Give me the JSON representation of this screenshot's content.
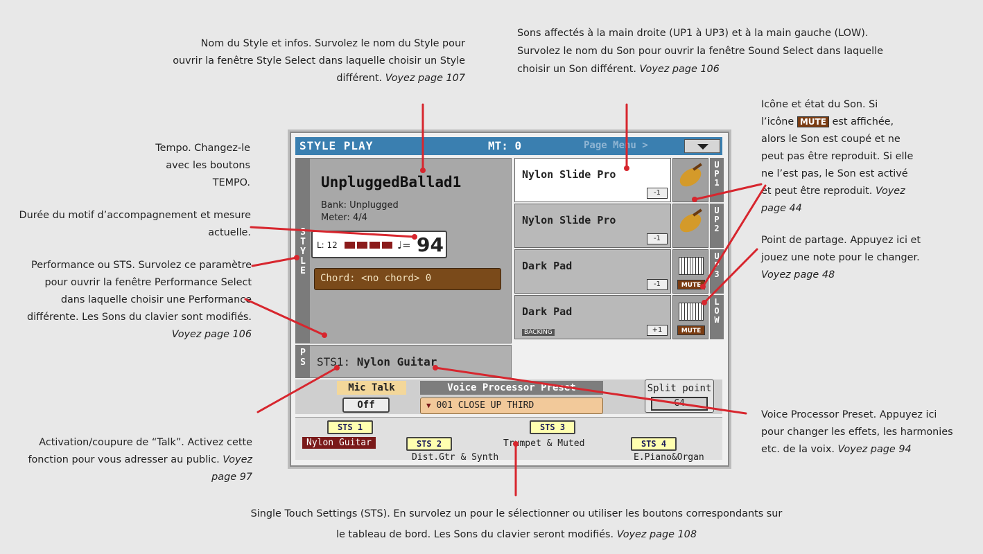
{
  "annotations": {
    "style_name": {
      "text": "Nom du Style et infos. Survolez le nom du Style pour ouvrir la fenêtre Style Select dans laquelle choisir un Style différent.",
      "ref": "Voyez page 107"
    },
    "sounds": {
      "text": "Sons affectés à la main droite (UP1 à UP3) et à la main gauche (LOW). Survolez le nom du Son pour ouvrir la fenêtre Sound Select dans laquelle choisir un Son différent.",
      "ref": "Voyez  page 106"
    },
    "icon_state": {
      "text_before": "Icône et état du Son. Si l’icône",
      "mute_label": "MUTE",
      "text_after": "est affichée, alors le Son est coupé et ne peut pas être reproduit. Si elle ne l’est pas, le Son est activé et peut être reproduit.",
      "ref": "Voyez page 44"
    },
    "tempo": {
      "text": "Tempo. Changez-le avec les boutons TEMPO."
    },
    "duration": {
      "text": "Durée du motif d’accompagnement et mesure actuelle."
    },
    "performance": {
      "text": "Performance ou STS. Survolez ce paramètre pour ouvrir la fenêtre Performance Select dans laquelle choisir une Performance différente. Les Sons du clavier sont modifiés.",
      "ref": "Voyez page 106"
    },
    "talk": {
      "text": "Activation/coupure de “Talk”. Activez cette fonction pour vous adresser au public.",
      "ref": "Voyez page 97"
    },
    "split": {
      "text": "Point de partage. Appuyez ici et jouez une note pour le changer.",
      "ref": "Voyez page 48"
    },
    "voice": {
      "text": "Voice Processor Preset. Appuyez ici pour changer les effets, les harmonies etc. de la voix.",
      "ref": "Voyez page 94"
    },
    "sts": {
      "text": "Single Touch Settings (STS). En survolez un pour le sélectionner ou utiliser les boutons correspondants sur le tableau de bord. Les Sons du clavier seront modifiés.",
      "ref": "Voyez  page 108"
    }
  },
  "screen": {
    "title": "STYLE PLAY",
    "mt": "MT: 0",
    "page_menu": "Page Menu >",
    "style_label": "STYLE",
    "style_name": "UnpluggedBallad1",
    "bank": "Bank:  Unplugged",
    "meter": "Meter:  4/4",
    "length": "L: 12",
    "tempo_symbol": "♩=",
    "tempo": "94",
    "chord": "Chord: <no chord> 0",
    "ps_label": "PS",
    "ps_prefix": "STS1: ",
    "ps_name": "Nylon Guitar",
    "tracks": [
      {
        "name": "Nylon Slide Pro",
        "octave": "-1",
        "label": "UP1",
        "icon": "guitar-icon",
        "muted": false,
        "selected": true
      },
      {
        "name": "Nylon Slide Pro",
        "octave": "-1",
        "label": "UP2",
        "icon": "guitar-icon",
        "muted": false,
        "selected": false
      },
      {
        "name": "Dark Pad",
        "octave": "-1",
        "label": "UP3",
        "icon": "pad-icon",
        "muted": true,
        "selected": false
      },
      {
        "name": "Dark Pad",
        "octave": "+1",
        "label": "LOW",
        "icon": "pad-icon",
        "muted": true,
        "selected": false,
        "badge": "BACKING"
      }
    ],
    "mute_label": "MUTE",
    "mic_talk_label": "Mic Talk",
    "mic_talk_value": "Off",
    "voice_label": "Voice Processor Preset",
    "voice_value": "001 CLOSE UP THIRD",
    "split_label": "Split point",
    "split_value": "C4",
    "sts": [
      {
        "button": "STS 1",
        "name": "Nylon Guitar"
      },
      {
        "button": "STS 2",
        "name": "Dist.Gtr & Synth"
      },
      {
        "button": "STS 3",
        "name": "Trumpet & Muted"
      },
      {
        "button": "STS 4",
        "name": "E.Piano&Organ"
      }
    ]
  },
  "colors": {
    "accent_red": "#d7262e",
    "title_blue": "#3a7fb0",
    "mute_brown": "#7a3c12"
  }
}
